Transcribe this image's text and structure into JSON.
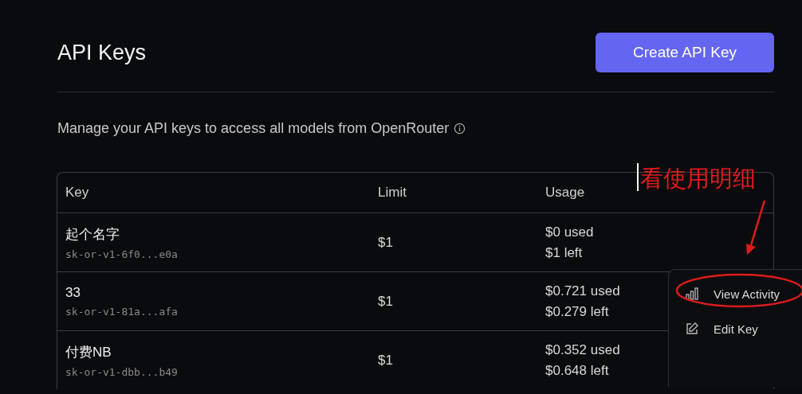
{
  "page": {
    "title": "API Keys",
    "create_button": "Create API Key",
    "description": "Manage your API keys to access all models from OpenRouter"
  },
  "table": {
    "columns": [
      "Key",
      "Limit",
      "Usage"
    ],
    "rows": [
      {
        "name": "起个名字",
        "key": "sk-or-v1-6f0...e0a",
        "limit": "$1",
        "used": "$0 used",
        "left": "$1 left"
      },
      {
        "name": "33",
        "key": "sk-or-v1-81a...afa",
        "limit": "$1",
        "used": "$0.721 used",
        "left": "$0.279 left"
      },
      {
        "name": "付费NB",
        "key": "sk-or-v1-dbb...b49",
        "limit": "$1",
        "used": "$0.352 used",
        "left": "$0.648 left"
      }
    ]
  },
  "menu": {
    "items": [
      {
        "kind": "activity",
        "label": "View Activity"
      },
      {
        "kind": "edit",
        "label": "Edit Key"
      }
    ]
  },
  "annotation": {
    "text": "看使用明细"
  }
}
